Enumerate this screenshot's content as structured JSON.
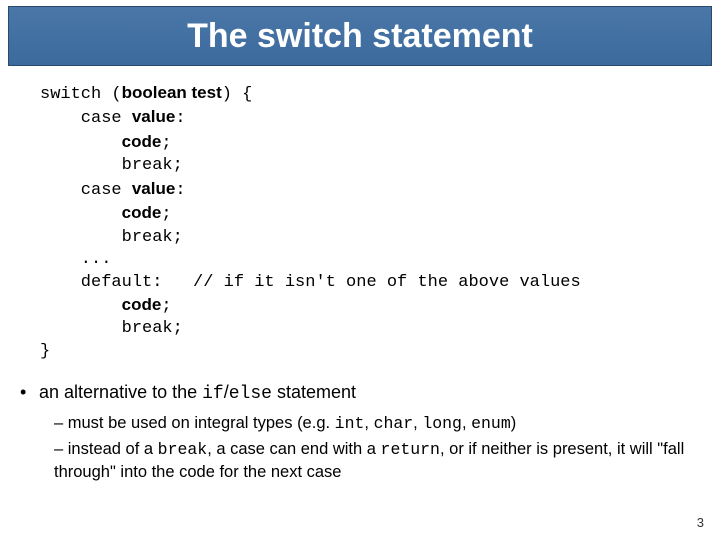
{
  "title": "The switch statement",
  "code": {
    "l1a": "switch (",
    "l1b": "boolean test",
    "l1c": ") {",
    "l2a": "    case ",
    "l2b": "value",
    "l2c": ":",
    "l3a": "        ",
    "l3b": "code",
    "l3c": ";",
    "l4": "        break;",
    "l5a": "    case ",
    "l5b": "value",
    "l5c": ":",
    "l6a": "        ",
    "l6b": "code",
    "l6c": ";",
    "l7": "        break;",
    "l8": "    ...",
    "l9": "    default:   // if it isn't one of the above values",
    "l10a": "        ",
    "l10b": "code",
    "l10c": ";",
    "l11": "        break;",
    "l12": "}"
  },
  "bullets": {
    "b1_pre": "an alternative to the ",
    "b1_code1": "if",
    "b1_slash": "/",
    "b1_code2": "else",
    "b1_post": " statement",
    "b2a_pre": "must be used on integral types  (e.g. ",
    "b2a_c1": "int",
    "b2a_s1": ", ",
    "b2a_c2": "char",
    "b2a_s2": ", ",
    "b2a_c3": "long",
    "b2a_s3": ", ",
    "b2a_c4": "enum",
    "b2a_post": ")",
    "b2b_pre": "instead of a ",
    "b2b_c1": "break",
    "b2b_mid1": ", a case can end with a ",
    "b2b_c2": "return",
    "b2b_mid2": ", or if neither is present, it will \"fall through\" into the code for the next case"
  },
  "pagenum": "3"
}
